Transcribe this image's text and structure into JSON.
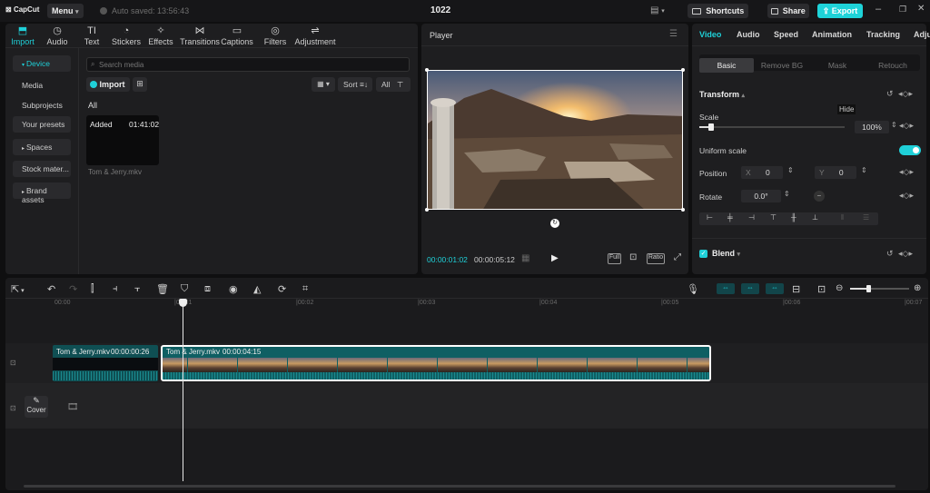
{
  "titlebar": {
    "app_name": "CapCut",
    "menu_label": "Menu",
    "autosave": "Auto saved: 13:56:43",
    "project_name": "1022",
    "shortcuts_label": "Shortcuts",
    "share_label": "Share",
    "export_label": "Export"
  },
  "media_tabs": [
    {
      "label": "Import",
      "icon": "import-icon",
      "glyph": "⬒"
    },
    {
      "label": "Audio",
      "icon": "audio-icon",
      "glyph": "◷"
    },
    {
      "label": "Text",
      "icon": "text-icon",
      "glyph": "TI"
    },
    {
      "label": "Stickers",
      "icon": "sticker-icon",
      "glyph": "◔"
    },
    {
      "label": "Effects",
      "icon": "effects-icon",
      "glyph": "✧"
    },
    {
      "label": "Transitions",
      "icon": "transitions-icon",
      "glyph": "⋈"
    },
    {
      "label": "Captions",
      "icon": "captions-icon",
      "glyph": "▭"
    },
    {
      "label": "Filters",
      "icon": "filters-icon",
      "glyph": "◎"
    },
    {
      "label": "Adjustment",
      "icon": "adjustment-icon",
      "glyph": "⇌"
    }
  ],
  "sidebar": {
    "items": [
      {
        "label": "Device",
        "arrow": "▾"
      },
      {
        "label": "Media",
        "arrow": ""
      },
      {
        "label": "Subprojects",
        "arrow": ""
      },
      {
        "label": "Your presets",
        "arrow": ""
      },
      {
        "label": "Spaces",
        "arrow": "▸"
      },
      {
        "label": "Stock mater...",
        "arrow": ""
      },
      {
        "label": "Brand assets",
        "arrow": "▸"
      }
    ]
  },
  "media": {
    "search_placeholder": "Search media",
    "import_label": "Import",
    "sort_label": "Sort",
    "all_label": "All",
    "section_label": "All",
    "clip": {
      "badge": "Added",
      "duration": "01:41:02",
      "filename": "Tom & Jerry.mkv"
    }
  },
  "player": {
    "title": "Player",
    "current_time": "00:00:01:02",
    "total_time": "00:00:05:12",
    "full_label": "Full",
    "ratio_label": "Ratio"
  },
  "inspector": {
    "tabs": [
      "Video",
      "Audio",
      "Speed",
      "Animation",
      "Tracking",
      "Adju"
    ],
    "sub_tabs": [
      "Basic",
      "Remove BG",
      "Mask",
      "Retouch"
    ],
    "transform_label": "Transform",
    "scale_label": "Scale",
    "scale_value": "100%",
    "scale_level": 0.08,
    "tooltip": "Hide",
    "uniform_scale_label": "Uniform scale",
    "uniform_scale_on": true,
    "position_label": "Position",
    "position_x_label": "X",
    "position_x": "0",
    "position_y_label": "Y",
    "position_y": "0",
    "rotate_label": "Rotate",
    "rotate_value": "0.0°",
    "blend_label": "Blend"
  },
  "timeline": {
    "ruler": [
      "00:00",
      "|00:01",
      "|00:02",
      "|00:03",
      "|00:04",
      "|00:05",
      "|00:06",
      "|00:07"
    ],
    "clip1": {
      "name": "Tom & Jerry.mkv",
      "duration": "00:00:00:26"
    },
    "clip2": {
      "name": "Tom & Jerry.mkv",
      "duration": "00:00:04:15"
    },
    "cover_label": "Cover"
  },
  "colors": {
    "accent": "#1fd0d8",
    "export_bg": "#1ed3d9",
    "clip_teal": "#0f5f63",
    "selected_border": "#ffffff"
  }
}
